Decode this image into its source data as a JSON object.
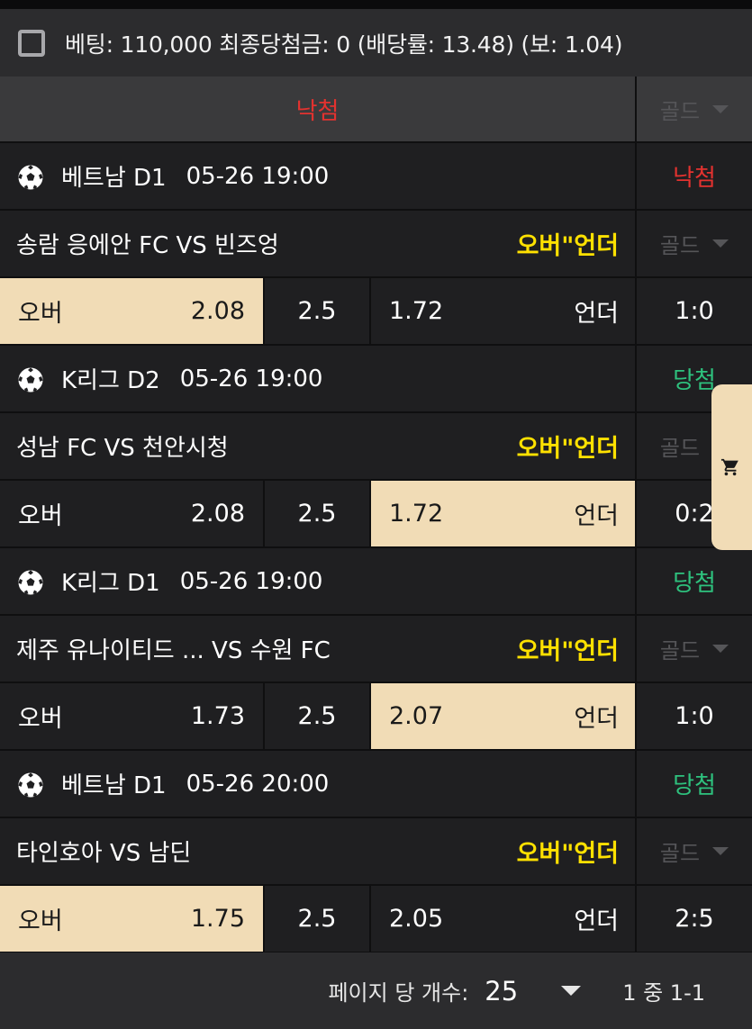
{
  "header": {
    "bet_text": "베팅: 110,000 최종당첨금: 0 (배당률: 13.48) (보: 1.04)"
  },
  "summary": {
    "status": "낙첨",
    "status_color": "#e3322f",
    "gold_label": "골드"
  },
  "games": [
    {
      "league": "베트남 D1",
      "time": "05-26 19:00",
      "result": "낙첨",
      "result_color": "#e3322f",
      "teams": "송람 응에안 FC VS 빈즈엉",
      "market": "오버\"언더",
      "gold_label": "골드",
      "over_label": "오버",
      "over_odds": "2.08",
      "line": "2.5",
      "under_odds": "1.72",
      "under_label": "언더",
      "score": "1:0",
      "selected": "over"
    },
    {
      "league": "K리그 D2",
      "time": "05-26 19:00",
      "result": "당첨",
      "result_color": "#2ec27e",
      "teams": "성남 FC VS 천안시청",
      "market": "오버\"언더",
      "gold_label": "골드",
      "over_label": "오버",
      "over_odds": "2.08",
      "line": "2.5",
      "under_odds": "1.72",
      "under_label": "언더",
      "score": "0:2",
      "selected": "under"
    },
    {
      "league": "K리그 D1",
      "time": "05-26 19:00",
      "result": "당첨",
      "result_color": "#2ec27e",
      "teams": "제주 유나이티드 ... VS 수원 FC",
      "market": "오버\"언더",
      "gold_label": "골드",
      "over_label": "오버",
      "over_odds": "1.73",
      "line": "2.5",
      "under_odds": "2.07",
      "under_label": "언더",
      "score": "1:0",
      "selected": "under"
    },
    {
      "league": "베트남 D1",
      "time": "05-26 20:00",
      "result": "당첨",
      "result_color": "#2ec27e",
      "teams": "타인호아 VS 남딘",
      "market": "오버\"언더",
      "gold_label": "골드",
      "over_label": "오버",
      "over_odds": "1.75",
      "line": "2.5",
      "under_odds": "2.05",
      "under_label": "언더",
      "score": "2:5",
      "selected": "over"
    }
  ],
  "footer": {
    "per_page_label": "페이지 당 개수:",
    "per_page_value": "25",
    "range_text": "1 중 1-1"
  },
  "colors": {
    "selected_bg": "#f1dcb6",
    "market_yellow": "#ffe100"
  },
  "icons": {
    "checkbox": "checkbox-icon",
    "ball": "soccer-ball-icon",
    "cart": "cart-icon",
    "dropdown": "chevron-down-icon"
  }
}
